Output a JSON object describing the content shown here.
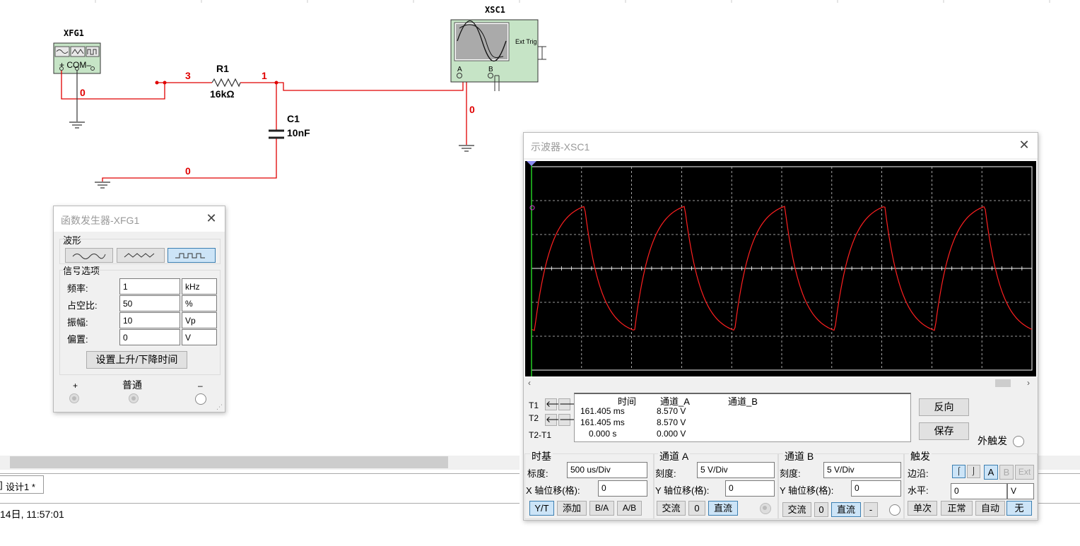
{
  "schematic": {
    "xfg_label": "XFG1",
    "xfg_terms": "+ COM–",
    "xsc_label": "XSC1",
    "ext_trig": "Ext Trig",
    "ch_a": "A",
    "ch_b": "B",
    "r1_name": "R1",
    "r1_value": "16kΩ",
    "c1_name": "C1",
    "c1_value": "10nF",
    "node_3": "3",
    "node_1": "1",
    "node_0a": "0",
    "node_0b": "0",
    "node_0c": "0"
  },
  "taskbar": {
    "tab_label": "设计1 *",
    "tab_prefix": "]",
    "status_time": "14日, 11:57:01"
  },
  "funcgen": {
    "title": "函数发生器-XFG1",
    "waveform_label": "波形",
    "signal_label": "信号选项",
    "freq_label": "频率:",
    "freq_value": "1",
    "freq_unit": "kHz",
    "duty_label": "占空比:",
    "duty_value": "50",
    "duty_unit": "%",
    "amp_label": "振幅:",
    "amp_value": "10",
    "amp_unit": "Vp",
    "offset_label": "偏置:",
    "offset_value": "0",
    "offset_unit": "V",
    "rise_fall_button": "设置上升/下降时间",
    "plus": "+",
    "common": "普通",
    "minus": "–",
    "selected_wave": "square"
  },
  "scope": {
    "title": "示波器-XSC1",
    "cursor_table": {
      "headers": [
        "时间",
        "通道_A",
        "通道_B"
      ],
      "rows": [
        {
          "label": "T1",
          "time": "161.405 ms",
          "cha": "8.570 V",
          "chb": ""
        },
        {
          "label": "T2",
          "time": "161.405 ms",
          "cha": "8.570 V",
          "chb": ""
        },
        {
          "label": "T2-T1",
          "time": "0.000 s",
          "cha": "0.000 V",
          "chb": ""
        }
      ]
    },
    "reverse_button": "反向",
    "save_button": "保存",
    "ext_trigger": "外触发",
    "timebase": {
      "title": "时基",
      "scale_label": "标度:",
      "scale_value": "500 us/Div",
      "xpos_label": "X 轴位移(格):",
      "xpos_value": "0",
      "yt": "Y/T",
      "add": "添加",
      "ba": "B/A",
      "ab": "A/B"
    },
    "chA": {
      "title": "通道 A",
      "scale_label": "刻度:",
      "scale_value": "5  V/Div",
      "ypos_label": "Y 轴位移(格):",
      "ypos_value": "0",
      "ac": "交流",
      "zero": "0",
      "dc": "直流"
    },
    "chB": {
      "title": "通道 B",
      "scale_label": "刻度:",
      "scale_value": "5  V/Div",
      "ypos_label": "Y 轴位移(格):",
      "ypos_value": "0",
      "ac": "交流",
      "zero": "0",
      "dc": "直流",
      "minus": "-"
    },
    "trigger": {
      "title": "触发",
      "edge_label": "边沿:",
      "level_label": "水平:",
      "level_value": "0",
      "level_unit": "V",
      "btn_a": "A",
      "btn_b": "B",
      "btn_ext": "Ext",
      "single": "单次",
      "normal": "正常",
      "auto": "自动",
      "none": "无"
    },
    "colors": {
      "trace": "#ff2020",
      "screen": "#000000",
      "cursor": "#22cc22"
    }
  }
}
